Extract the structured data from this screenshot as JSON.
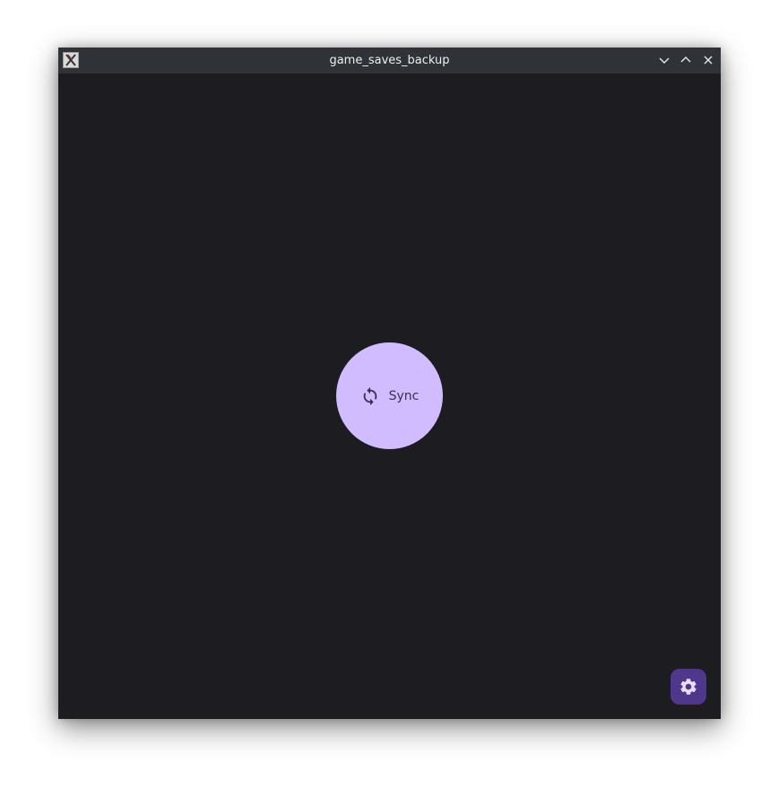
{
  "window": {
    "title": "game_saves_backup",
    "controls": [
      "minimize",
      "maximize",
      "close"
    ]
  },
  "main": {
    "sync_button": {
      "label": "Sync",
      "icon": "sync-icon"
    },
    "settings_button": {
      "icon": "gear-icon"
    }
  },
  "colors": {
    "background": "#1d1c21",
    "titlebar": "#2f3337",
    "sync_button_fill": "#d0bcff",
    "sync_button_text": "#3b2f5a",
    "fab_fill": "#4f378b",
    "fab_icon": "#e8def8"
  }
}
